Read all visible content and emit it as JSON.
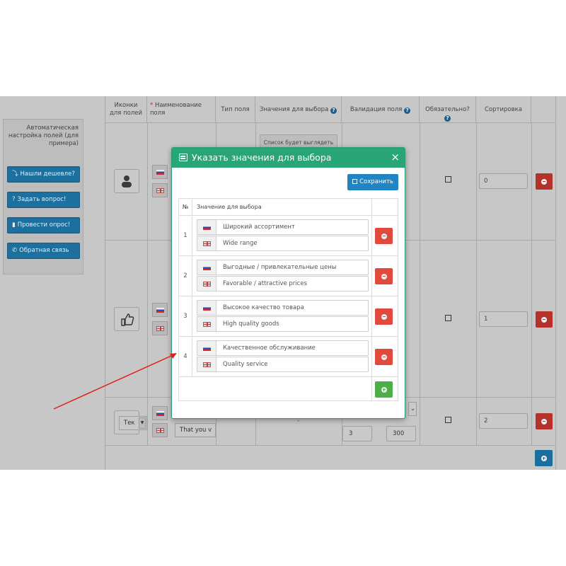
{
  "sidebar": {
    "title": "Автоматическая настройка полей (для примера)",
    "buttons": [
      {
        "icon": "⤵",
        "label": "Нашли дешевле?"
      },
      {
        "icon": "?",
        "label": "Задать вопрос!"
      },
      {
        "icon": "▮",
        "label": "Провести опрос!"
      },
      {
        "icon": "✆",
        "label": "Обратная связь"
      }
    ]
  },
  "table": {
    "headers": {
      "icons": "Иконки для полей",
      "name_req": "*",
      "name": "Наименование поля",
      "type": "Тип поля",
      "values": "Значения для выбора",
      "validation": "Валидация поля",
      "required": "Обязательно?",
      "sorting": "Сортировка"
    },
    "rows": [
      {
        "sort": "0"
      },
      {
        "sort": "1"
      },
      {
        "sort": "2",
        "name_en": "That you v",
        "type": "Тек",
        "val_min": "3",
        "val_max": "300"
      }
    ],
    "preview_label": "Список будет выглядеть",
    "dash": "-",
    "help_icon": "?"
  },
  "modal": {
    "title": "Указать значения для выбора",
    "close": "×",
    "save_label": "Сохранить",
    "col_num": "№",
    "col_value": "Значение для выбора",
    "items": [
      {
        "num": "1",
        "ru": "Широкий ассортимент",
        "en": "Wide range"
      },
      {
        "num": "2",
        "ru": "Выгодные / привлекательные цены",
        "en": "Favorable / attractive prices"
      },
      {
        "num": "3",
        "ru": "Высокое качество товара",
        "en": "High quality goods"
      },
      {
        "num": "4",
        "ru": "Качественное обслуживание",
        "en": "Quality service"
      }
    ]
  },
  "colors": {
    "modal_header": "#29a677",
    "save": "#2185c4",
    "delete": "#e04a3d",
    "add": "#4dae4a",
    "arrow": "#e0201b"
  }
}
